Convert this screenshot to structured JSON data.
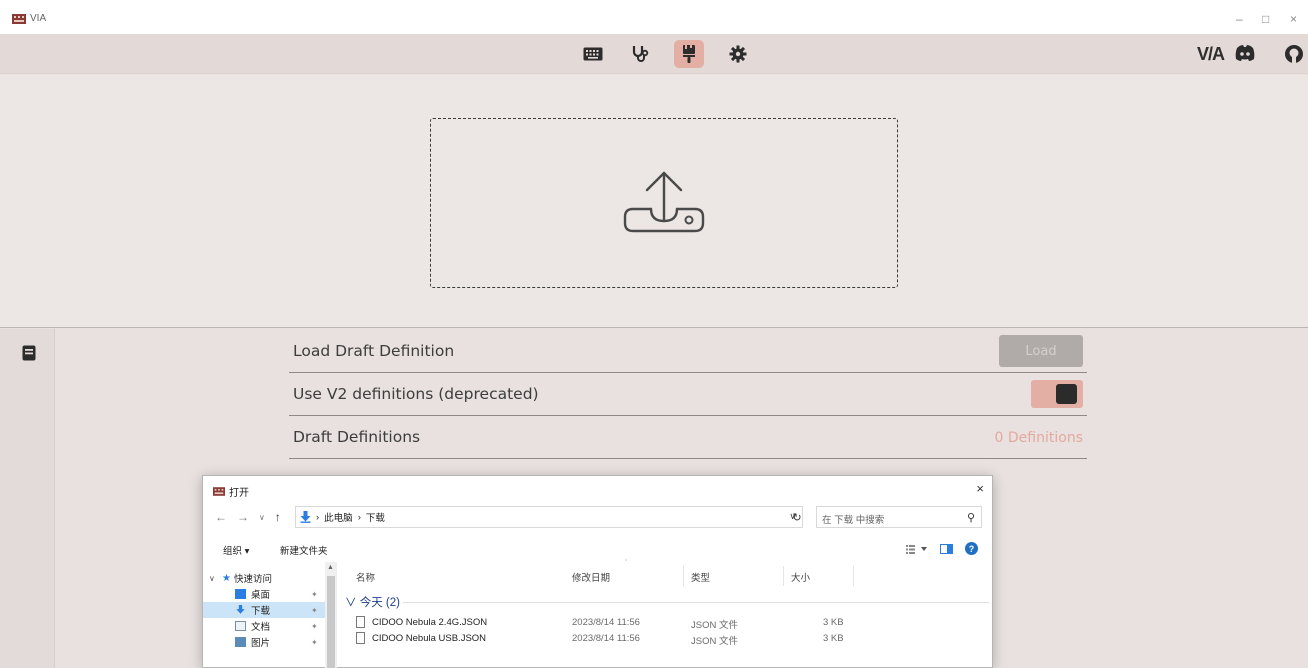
{
  "window": {
    "app_name": "VIA",
    "minimize": "–",
    "maximize": "□",
    "close": "×"
  },
  "toolbar": {
    "icons": [
      "keyboard-icon",
      "stethoscope-icon",
      "paintbrush-icon",
      "gear-icon"
    ],
    "active": "paintbrush-icon",
    "brand": "V/A",
    "right_icons": [
      "discord-icon",
      "github-icon"
    ]
  },
  "settings": {
    "rows": [
      {
        "label": "Load Draft Definition",
        "button": "Load"
      },
      {
        "label": "Use V2 definitions (deprecated)",
        "toggle_on": true
      },
      {
        "label": "Draft Definitions",
        "count": "0 Definitions"
      }
    ]
  },
  "dialog": {
    "title": "打开",
    "close": "×",
    "nav": {
      "back": "←",
      "forward": "→",
      "recent": "∨",
      "up": "↑"
    },
    "path": [
      "此电脑",
      "下载"
    ],
    "path_sep": "›",
    "search_placeholder": "在 下载 中搜索",
    "organize": "组织 ▾",
    "new_folder": "新建文件夹",
    "nav_items": [
      {
        "chevron": "∨",
        "label": "快速访问"
      },
      {
        "label": "桌面",
        "pin": "📌"
      },
      {
        "label": "下载",
        "pin": "📌"
      },
      {
        "label": "文档",
        "pin": "📌"
      },
      {
        "label": "图片",
        "pin": "📌"
      }
    ],
    "columns": [
      "名称",
      "修改日期",
      "类型",
      "大小"
    ],
    "group_label": "∨ 今天 (2)",
    "files": [
      {
        "name": "CIDOO Nebula 2.4G.JSON",
        "date": "2023/8/14 11:56",
        "type": "JSON 文件",
        "size": "3 KB"
      },
      {
        "name": "CIDOO Nebula USB.JSON",
        "date": "2023/8/14 11:56",
        "type": "JSON 文件",
        "size": "3 KB"
      }
    ]
  },
  "colors": {
    "accent": "#e3aea4",
    "background": "#e8e1df",
    "count_text": "#e4a99e"
  }
}
